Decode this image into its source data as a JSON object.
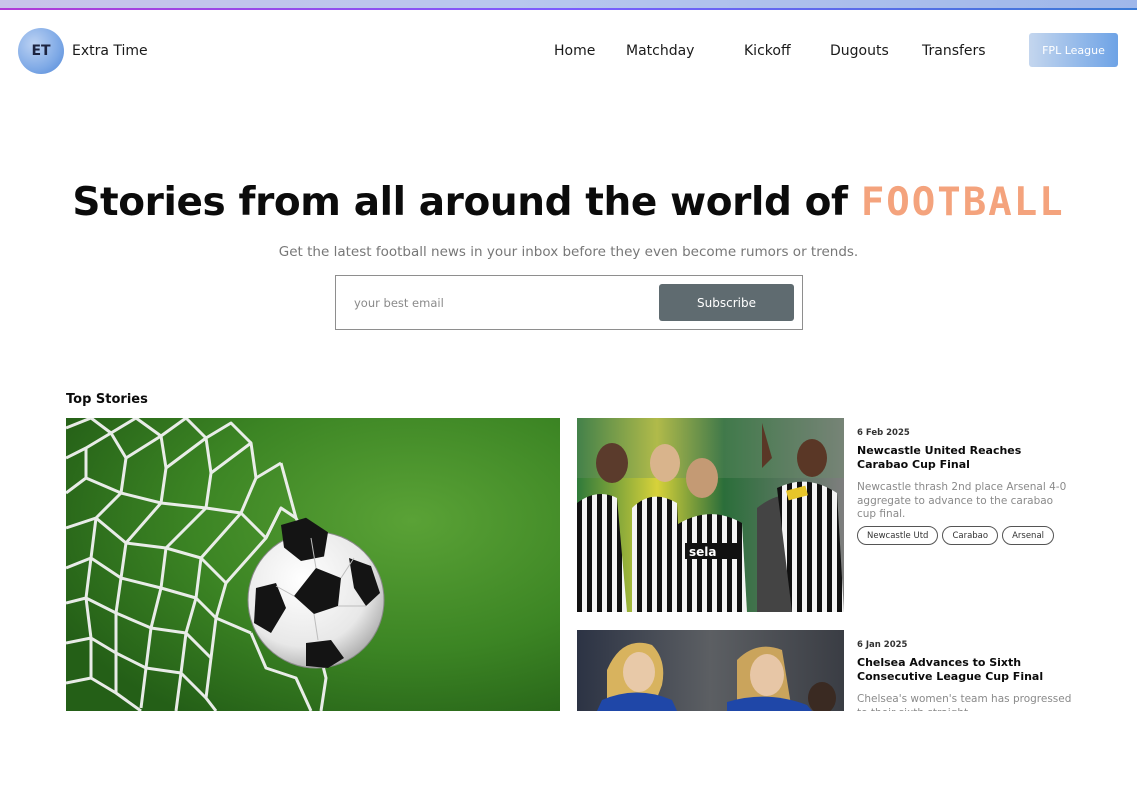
{
  "brand": {
    "initials": "ET",
    "name": "Extra Time"
  },
  "nav": {
    "links": [
      "Home",
      "Matchday",
      "Kickoff",
      "Dugouts",
      "Transfers"
    ],
    "cta": "FPL League"
  },
  "hero": {
    "title": "Stories from all around the world of",
    "title_accent": "FOOTBALL",
    "subtitle": "Get the latest football news in your inbox before they even become rumors or trends.",
    "email_placeholder": "your best email",
    "subscribe_label": "Subscribe"
  },
  "top_stories": {
    "heading": "Top Stories",
    "stories": [
      {
        "date": "6 Feb 2025",
        "title": "Newcastle United Reaches Carabao Cup Final",
        "description": "Newcastle thrash 2nd place Arsenal 4-0 aggregate to advance to the carabao cup final.",
        "tags": [
          "Newcastle Utd",
          "Carabao",
          "Arsenal"
        ],
        "shirt_sponsor": "sela"
      },
      {
        "date": "6 Jan 2025",
        "title": "Chelsea Advances to Sixth Consecutive League Cup Final",
        "description": "Chelsea's women's team has progressed to their sixth straight",
        "tags": []
      }
    ]
  },
  "colors": {
    "accent_orange": "#f4a37d",
    "subscribe_button": "#5f6b70",
    "cta_gradient_start": "#c4d6ee",
    "cta_gradient_end": "#6ea3e6"
  },
  "icons": {
    "logo": "et-badge-icon"
  }
}
